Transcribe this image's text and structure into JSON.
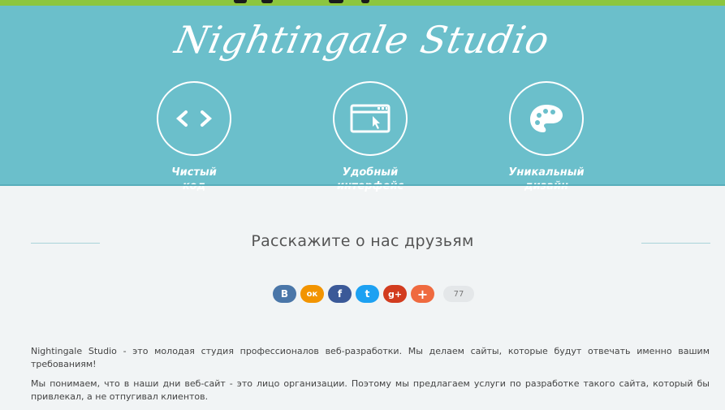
{
  "hero": {
    "logo": "Nightingale Studio",
    "features": [
      {
        "icon": "code-icon",
        "label": "Чистый\nкод"
      },
      {
        "icon": "browser-window-icon",
        "label": "Удобный\nинтерфейс"
      },
      {
        "icon": "palette-icon",
        "label": "Уникальный\nдизайн"
      }
    ],
    "background": "#6bbfcb"
  },
  "share": {
    "title": "Расскажите о нас друзьям",
    "buttons": [
      {
        "name": "vkontakte",
        "glyph": "B",
        "color": "#4a76a8"
      },
      {
        "name": "odnoklassniki",
        "glyph": "ок",
        "color": "#f29400"
      },
      {
        "name": "facebook",
        "glyph": "f",
        "color": "#3b5998"
      },
      {
        "name": "twitter",
        "glyph": "t",
        "color": "#1da1f2"
      },
      {
        "name": "google-plus",
        "glyph": "g+",
        "color": "#d23c1f"
      },
      {
        "name": "more",
        "glyph": "+",
        "color": "#ef6a3f"
      }
    ],
    "count": "77"
  },
  "content": {
    "paragraph_1": "Nightingale Studio - это молодая студия профессионалов веб-разработки. Мы делаем сайты, которые будут отвечать именно вашим требованиям!",
    "paragraph_2": "Мы понимаем, что в наши дни веб-сайт - это лицо организации. Поэтому мы предлагаем услуги по разработке такого сайта, который бы привлекал, а не отпугивал клиентов."
  }
}
